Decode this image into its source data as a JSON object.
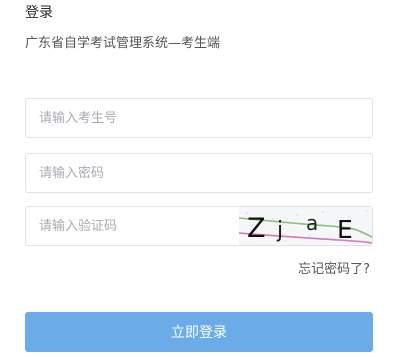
{
  "header": {
    "title": "登录",
    "subtitle": "广东省自学考试管理系统—考生端"
  },
  "form": {
    "student_id_placeholder": "请输入考生号",
    "password_placeholder": "请输入密码",
    "captcha_placeholder": "请输入验证码",
    "captcha_text": [
      "Z",
      "j",
      "a",
      "E"
    ],
    "forgot_label": "忘记密码了?",
    "submit_label": "立即登录"
  },
  "colors": {
    "primary_button": "#6aabe8",
    "border": "#dfe3e8",
    "placeholder": "#a8acb2"
  }
}
